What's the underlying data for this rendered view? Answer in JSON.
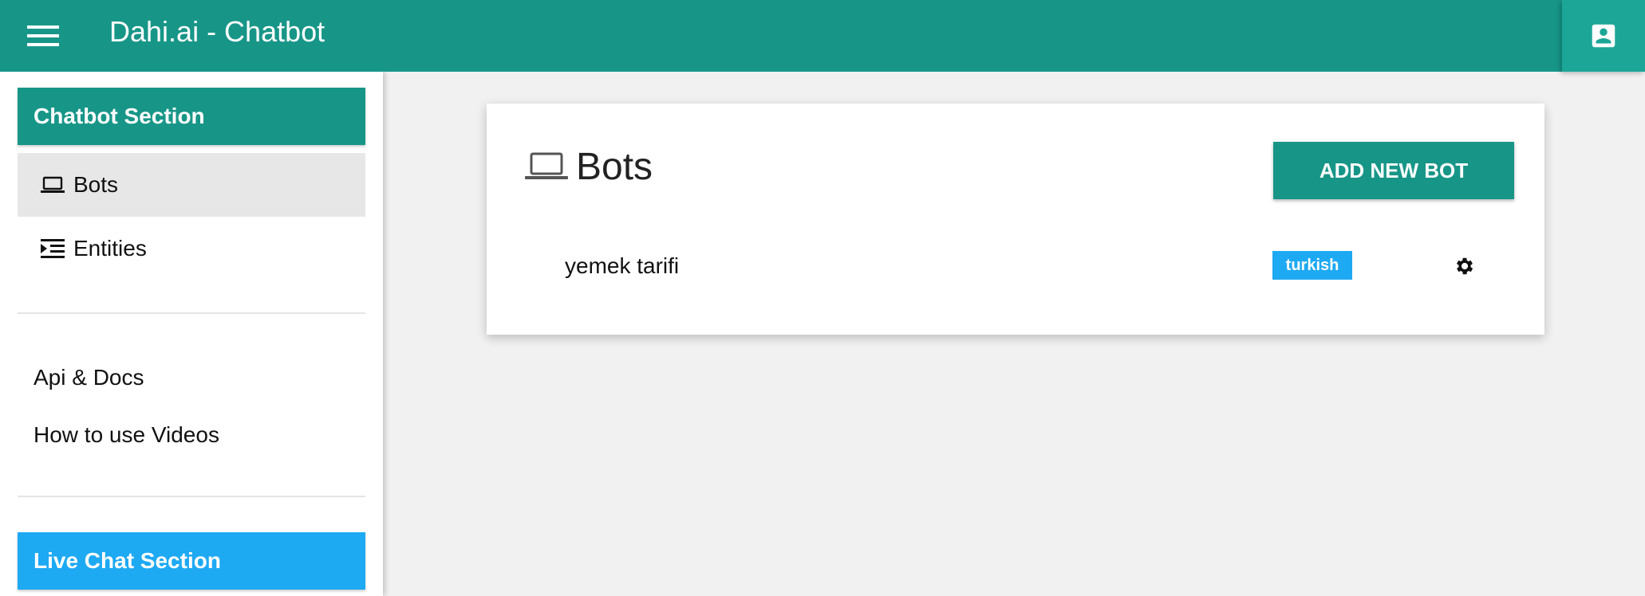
{
  "topbar": {
    "title": "Dahi.ai - Chatbot",
    "menu_icon": "hamburger-menu-icon",
    "account_icon": "account-box-icon"
  },
  "sidebar": {
    "chatbot_section": "Chatbot Section",
    "items": [
      {
        "label": "Bots",
        "icon": "laptop-icon",
        "active": true
      },
      {
        "label": "Entities",
        "icon": "format-indent-icon",
        "active": false
      }
    ],
    "links": [
      {
        "label": "Api & Docs"
      },
      {
        "label": "How to use Videos"
      }
    ],
    "live_chat_section": "Live Chat Section"
  },
  "main": {
    "title": "Bots",
    "title_icon": "laptop-icon",
    "add_button": "ADD NEW BOT",
    "bots": [
      {
        "name": "yemek tarifi",
        "language": "turkish",
        "settings_icon": "gear-icon"
      }
    ]
  },
  "colors": {
    "primary": "#179688",
    "accent": "#1ea9f3",
    "background": "#f1f1f1"
  }
}
